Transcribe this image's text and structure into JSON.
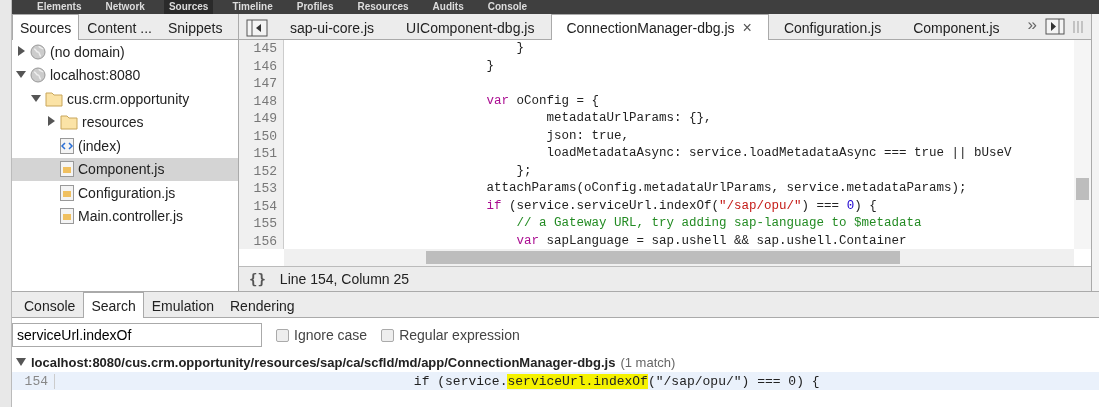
{
  "top_bar": {
    "tabs": [
      {
        "label": "Elements",
        "selected": false
      },
      {
        "label": "Network",
        "selected": false
      },
      {
        "label": "Sources",
        "selected": true
      },
      {
        "label": "Timeline",
        "selected": false
      },
      {
        "label": "Profiles",
        "selected": false
      },
      {
        "label": "Resources",
        "selected": false
      },
      {
        "label": "Audits",
        "selected": false
      },
      {
        "label": "Console",
        "selected": false
      }
    ]
  },
  "navigator": {
    "tabs": [
      {
        "label": "Sources",
        "selected": true
      },
      {
        "label": "Content ...",
        "selected": false
      },
      {
        "label": "Snippets",
        "selected": false
      }
    ],
    "tree": [
      {
        "label": "(no domain)",
        "kind": "domain",
        "expanded": false,
        "selected": false
      },
      {
        "label": "localhost:8080",
        "kind": "domain",
        "expanded": true,
        "selected": false,
        "children": [
          {
            "label": "cus.crm.opportunity",
            "kind": "folder",
            "expanded": true,
            "selected": false,
            "children": [
              {
                "label": "resources",
                "kind": "folder",
                "expanded": false,
                "selected": false
              },
              {
                "label": "(index)",
                "kind": "html",
                "selected": false
              },
              {
                "label": "Component.js",
                "kind": "script",
                "selected": true
              },
              {
                "label": "Configuration.js",
                "kind": "script",
                "selected": false
              },
              {
                "label": "Main.controller.js",
                "kind": "script",
                "selected": false
              }
            ]
          }
        ]
      }
    ]
  },
  "editor": {
    "overflow": "»",
    "tabs": [
      {
        "label": "sap-ui-core.js",
        "selected": false
      },
      {
        "label": "UIComponent-dbg.js",
        "selected": false
      },
      {
        "label": "ConnectionManager-dbg.js",
        "selected": true,
        "close": "×"
      },
      {
        "label": "Configuration.js",
        "selected": false
      },
      {
        "label": "Component.js",
        "selected": false
      }
    ],
    "lines": [
      {
        "number": "145",
        "tokens": [
          {
            "text": "                               }",
            "kind": "plain"
          }
        ]
      },
      {
        "number": "146",
        "tokens": [
          {
            "text": "                           }",
            "kind": "plain"
          }
        ]
      },
      {
        "number": "147"
      },
      {
        "number": "148",
        "tokens": [
          {
            "text": "                           var",
            "kind": "keyword"
          },
          {
            "text": " oConfig = {",
            "kind": "plain"
          }
        ]
      },
      {
        "number": "149",
        "tokens": [
          {
            "text": "                                   metadataUrlParams: {},",
            "kind": "plain"
          }
        ]
      },
      {
        "number": "150",
        "tokens": [
          {
            "text": "                                   json: true,",
            "kind": "plain"
          }
        ]
      },
      {
        "number": "151",
        "tokens": [
          {
            "text": "                                   loadMetadataAsync: service.loadMetadataAsync === true || bUseV",
            "kind": "plain"
          }
        ]
      },
      {
        "number": "152",
        "tokens": [
          {
            "text": "                               };",
            "kind": "plain"
          }
        ]
      },
      {
        "number": "153",
        "tokens": [
          {
            "text": "                           attachParams(oConfig.metadataUrlParams, service.metadataParams);",
            "kind": "plain"
          }
        ]
      },
      {
        "number": "154",
        "tokens": [
          {
            "text": "                           if",
            "kind": "keyword"
          },
          {
            "text": " (service.serviceUrl.indexOf(",
            "kind": "plain"
          },
          {
            "text": "\"/sap/opu/\"",
            "kind": "string"
          },
          {
            "text": ") === ",
            "kind": "plain"
          },
          {
            "text": "0",
            "kind": "number"
          },
          {
            "text": ") {",
            "kind": "plain"
          }
        ]
      },
      {
        "number": "155",
        "tokens": [
          {
            "text": "                               // a Gateway URL, try adding sap-language to $metadata",
            "kind": "comment"
          }
        ]
      },
      {
        "number": "156",
        "tokens": [
          {
            "text": "                               var",
            "kind": "keyword"
          },
          {
            "text": " sapLanguage = sap.ushell && sap.ushell.Container",
            "kind": "plain"
          }
        ]
      }
    ],
    "pretty_print": "{}",
    "status": "Line 154, Column 25"
  },
  "drawer": {
    "tabs": [
      {
        "label": "Console",
        "selected": false
      },
      {
        "label": "Search",
        "selected": true
      },
      {
        "label": "Emulation",
        "selected": false
      },
      {
        "label": "Rendering",
        "selected": false
      }
    ],
    "search": {
      "value": "serviceUrl.indexOf",
      "options": [
        {
          "label": "Ignore case",
          "checked": false
        },
        {
          "label": "Regular expression",
          "checked": false
        }
      ]
    },
    "results": [
      {
        "file": "localhost:8080/cus.crm.opportunity/resources/sap/ca/scfld/md/app/ConnectionManager-dbg.js",
        "count": "(1 match)",
        "expanded": true,
        "matches": [
          {
            "line": "154",
            "before": "                                              if (service.",
            "match": "serviceUrl.indexOf",
            "after": "(\"/sap/opu/\") === 0) {"
          }
        ]
      }
    ]
  }
}
